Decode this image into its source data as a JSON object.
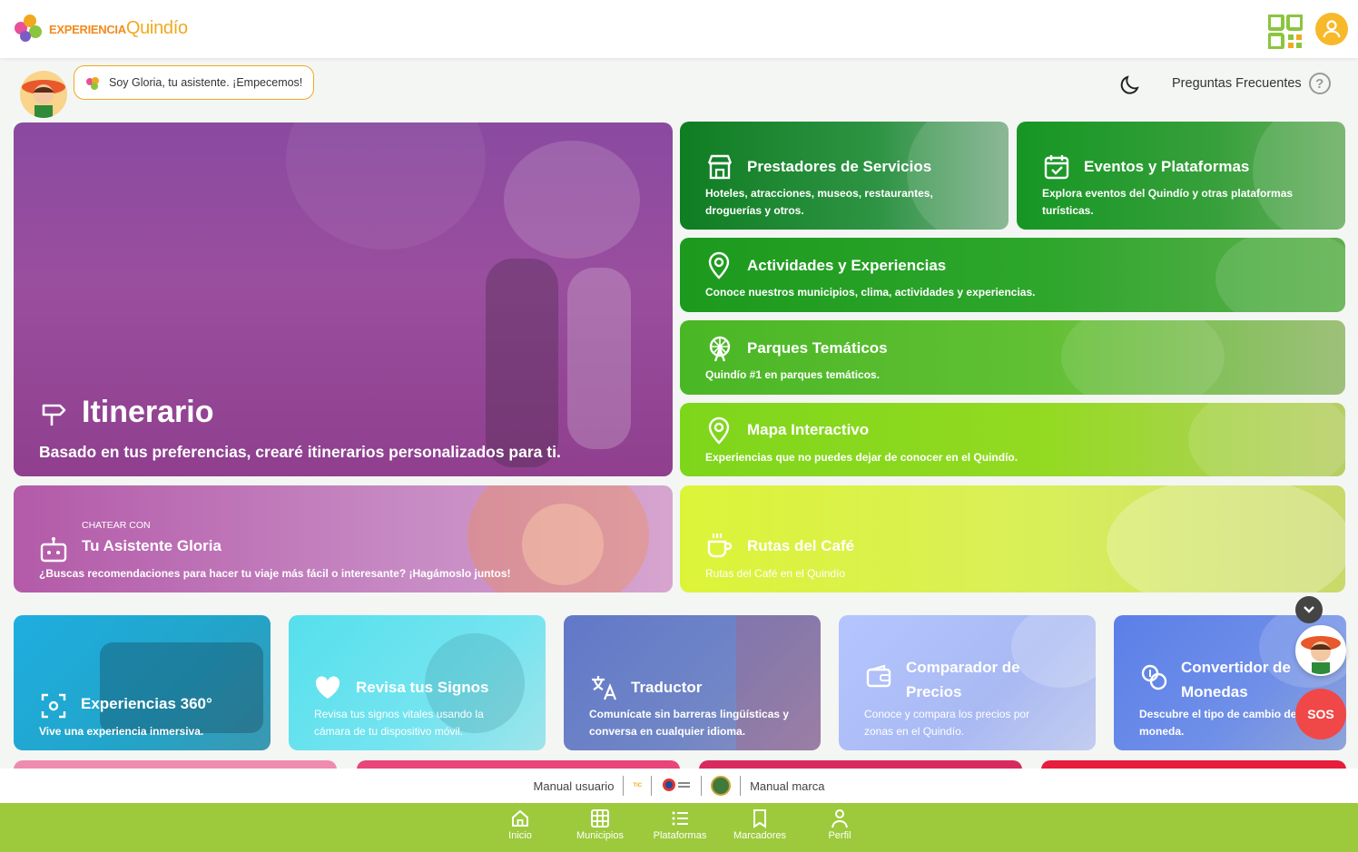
{
  "header": {
    "logo_part1": "EXPERIENCIA",
    "logo_part2": "Quindío",
    "qr_icon": "qr-code-icon",
    "user_icon": "user-icon"
  },
  "assistant": {
    "greeting": "Soy Gloria, tu asistente. ¡Empecemos!"
  },
  "top_right": {
    "theme_icon": "moon-icon",
    "faq_label": "Preguntas Frecuentes",
    "faq_icon_glyph": "?"
  },
  "cards": {
    "itinerario": {
      "title": "Itinerario",
      "desc": "Basado en tus preferencias, crearé itinerarios personalizados para ti."
    },
    "gloria_chat": {
      "kicker": "CHATEAR CON",
      "title": "Tu Asistente Gloria",
      "desc": "¿Buscas recomendaciones para hacer tu viaje más fácil o interesante? ¡Hagámoslo juntos!"
    },
    "prestadores": {
      "title": "Prestadores de Servicios",
      "desc": "Hoteles, atracciones, museos, restaurantes, droguerías y otros."
    },
    "eventos": {
      "title": "Eventos y Plataformas",
      "desc": "Explora eventos del Quindío y otras plataformas turísticas."
    },
    "actividades": {
      "title": "Actividades y Experiencias",
      "desc": "Conoce nuestros municipios, clima, actividades y experiencias."
    },
    "parques": {
      "title": "Parques Temáticos",
      "desc": "Quindío #1 en parques temáticos."
    },
    "mapa": {
      "title": "Mapa Interactivo",
      "desc": "Experiencias que no puedes dejar de conocer en el Quindío."
    },
    "rutas": {
      "title": "Rutas del Café",
      "desc": "Rutas del Café en el Quindío"
    },
    "exp360": {
      "title": "Experiencias 360°",
      "desc": "Vive una experiencia inmersiva."
    },
    "signos": {
      "title": "Revisa tus Signos",
      "desc": "Revisa tus signos vitales usando la cámara de tu dispositivo móvil."
    },
    "traductor": {
      "title": "Traductor",
      "desc": "Comunícate sin barreras lingüísticas y conversa en cualquier idioma."
    },
    "comparador": {
      "title": "Comparador de Precios",
      "desc": "Conoce y compara los precios por zonas en el Quindío."
    },
    "convertidor": {
      "title": "Convertidor de Monedas",
      "desc": "Descubre el tipo de cambio de moneda."
    }
  },
  "footer": {
    "manual_usuario": "Manual usuario",
    "manual_marca": "Manual marca",
    "tic_logo_text": "TIC"
  },
  "floating": {
    "sos_label": "SOS"
  },
  "nav": [
    {
      "label": "Inicio",
      "icon": "home-icon"
    },
    {
      "label": "Municipios",
      "icon": "grid-icon"
    },
    {
      "label": "Plataformas",
      "icon": "list-icon"
    },
    {
      "label": "Marcadores",
      "icon": "bookmark-icon"
    },
    {
      "label": "Perfil",
      "icon": "person-icon"
    }
  ],
  "colors": {
    "brand_orange": "#f2a81e",
    "nav_green": "#9cca3c",
    "sos_red": "#f04848"
  }
}
